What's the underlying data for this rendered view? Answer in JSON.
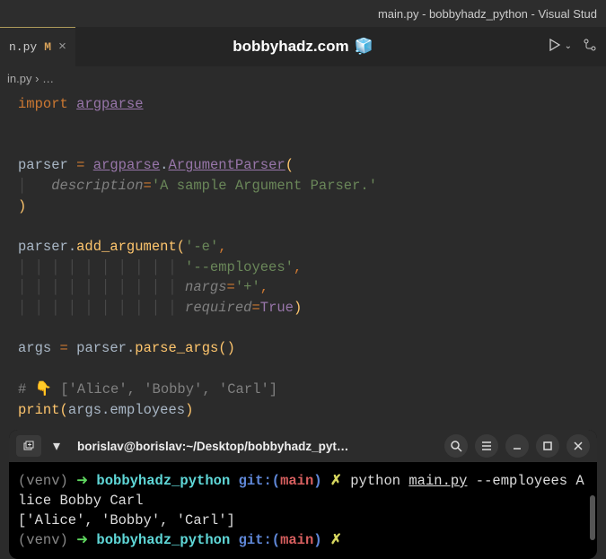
{
  "window": {
    "title": "main.py - bobbyhadz_python - Visual Stud"
  },
  "tab": {
    "filename": "n.py",
    "modified": "M",
    "close": "×"
  },
  "header": {
    "site": "bobbyhadz.com",
    "icon": "🧊"
  },
  "breadcrumb": {
    "file": "in.py",
    "sep": "›",
    "rest": "…"
  },
  "code": {
    "import_kw": "import",
    "argparse": "argparse",
    "parser_var": "parser",
    "eq": "=",
    "dot": ".",
    "ArgumentParser": "ArgumentParser",
    "description_kw": "description",
    "description_val": "'A sample Argument Parser.'",
    "add_argument": "add_argument",
    "arg_short": "'-e'",
    "arg_long": "'--employees'",
    "nargs_kw": "nargs",
    "nargs_val": "'+'",
    "required_kw": "required",
    "true_val": "True",
    "args_var": "args",
    "parse_args": "parse_args",
    "comment": "# 👇 ['Alice', 'Bobby', 'Carl']",
    "print": "print",
    "employees": "employees",
    "comma": ","
  },
  "terminal": {
    "title": "borislav@borislav:~/Desktop/bobbyhadz_pyt…",
    "venv": "(venv)",
    "arrow": "➜ ",
    "dir": "bobbyhadz_python",
    "git_label": "git:(",
    "branch": "main",
    "git_close": ")",
    "dirty": "✗",
    "cmd": "python ",
    "script": "main.py",
    "args": " --employees Alice Bobby Carl",
    "output": "['Alice', 'Bobby', 'Carl']"
  }
}
